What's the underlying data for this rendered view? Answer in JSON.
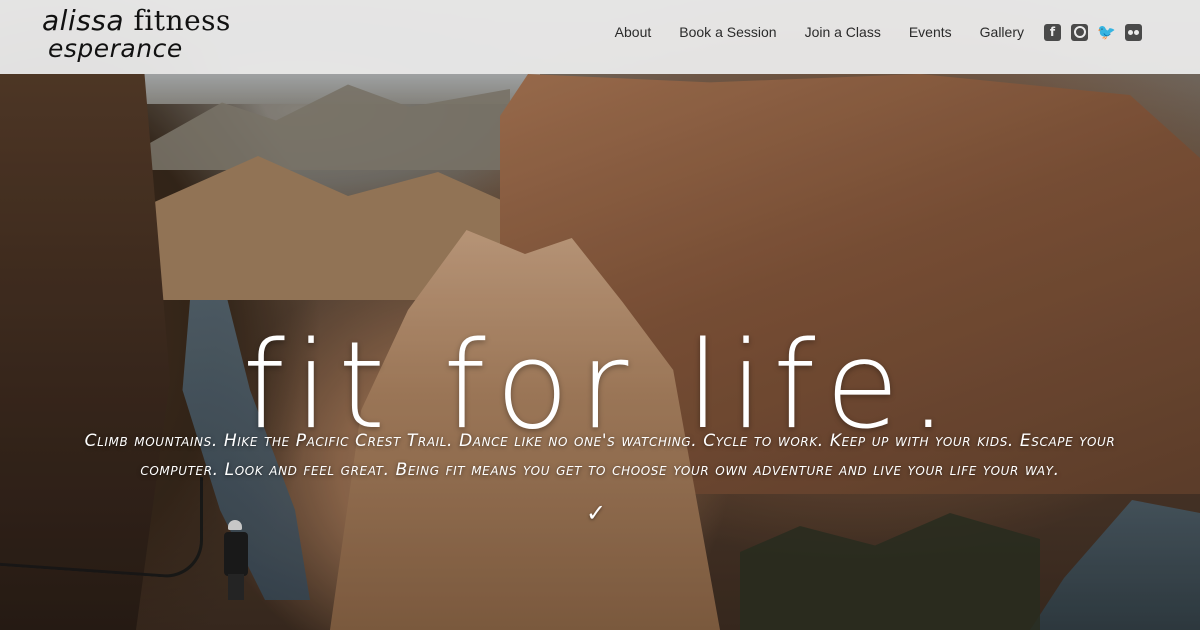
{
  "brand": {
    "line1_a": "alissa",
    "line1_b": " fitness",
    "line2": "esperance"
  },
  "nav": {
    "items": [
      "About",
      "Book a Session",
      "Join a Class",
      "Events",
      "Gallery"
    ]
  },
  "social": {
    "icons": [
      "facebook-icon",
      "instagram-icon",
      "twitter-icon",
      "flickr-icon"
    ]
  },
  "hero": {
    "headline": "fit for life.",
    "tagline": "Climb mountains. Hike the Pacific Crest Trail. Dance like no one's watching. Cycle to work. Keep up with your kids. Escape your computer. Look and feel great. Being fit means you get to choose your own adventure and live your life your way.",
    "scroll_glyph": "✓"
  },
  "colors": {
    "header_bg": "#ececec",
    "nav_text": "#2b2b2b",
    "hero_text": "#ffffff"
  }
}
